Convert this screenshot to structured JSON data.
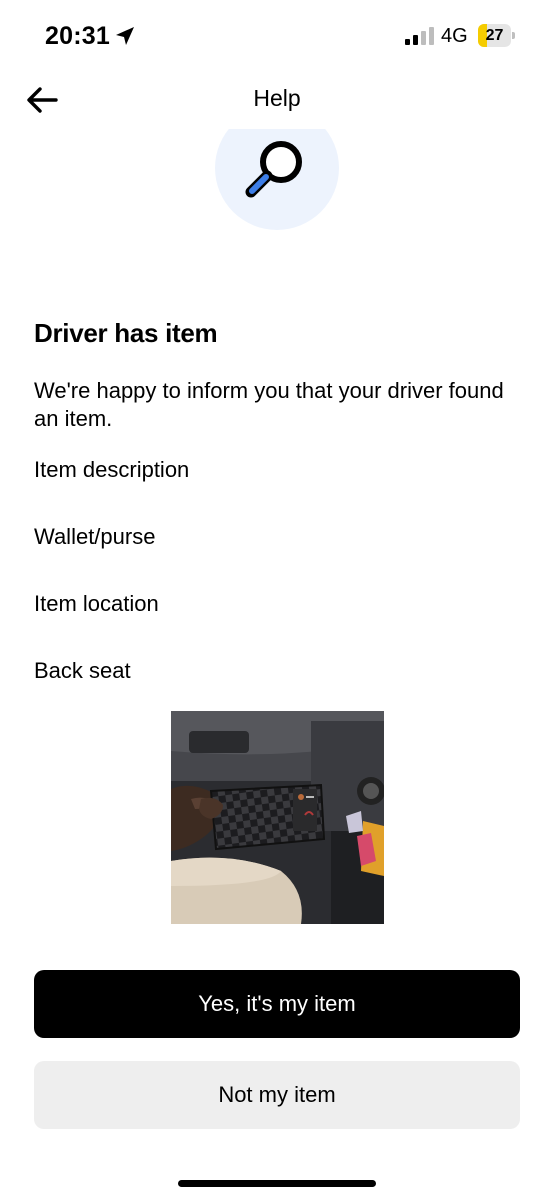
{
  "status_bar": {
    "time": "20:31",
    "network": "4G",
    "battery": "27",
    "battery_level": 0.27,
    "location_icon": "location-arrow-icon",
    "signal_icon": "cellular-signal-icon",
    "battery_color": "#f5cc00"
  },
  "nav": {
    "title": "Help",
    "back_icon": "back-arrow-icon"
  },
  "hero": {
    "icon": "magnifying-glass-icon",
    "circle_color": "#edf3fd"
  },
  "content": {
    "heading": "Driver has item",
    "intro": "We're happy to inform you that your driver found an item.",
    "item_description_label": "Item description",
    "item_description_value": "Wallet/purse",
    "item_location_label": "Item location",
    "item_location_value": "Back seat"
  },
  "actions": {
    "confirm_label": "Yes, it's my item",
    "reject_label": "Not my item"
  }
}
